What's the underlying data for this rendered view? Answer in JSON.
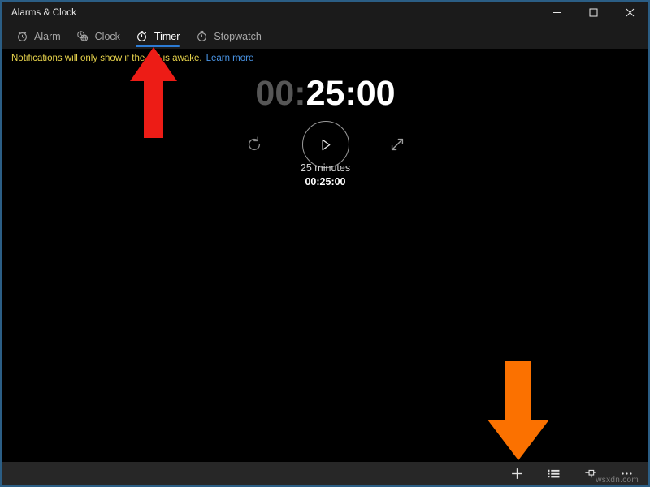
{
  "window": {
    "title": "Alarms & Clock",
    "controls": [
      {
        "name": "minimize",
        "label": "Minimize"
      },
      {
        "name": "maximize",
        "label": "Maximize"
      },
      {
        "name": "close",
        "label": "Close"
      }
    ],
    "accent_color": "#2b5e85"
  },
  "tabs": [
    {
      "id": "alarm",
      "label": "Alarm",
      "icon": "alarm-clock-icon",
      "active": false
    },
    {
      "id": "clock",
      "label": "Clock",
      "icon": "world-clock-icon",
      "active": false
    },
    {
      "id": "timer",
      "label": "Timer",
      "icon": "timer-icon",
      "active": true
    },
    {
      "id": "stopwatch",
      "label": "Stopwatch",
      "icon": "stopwatch-icon",
      "active": false
    }
  ],
  "notification": {
    "text": "Notifications will only show if the PC is awake.",
    "link_label": "Learn more",
    "text_color": "#e8d44c",
    "link_color": "#4a96e8"
  },
  "timer": {
    "display_dim": "00:",
    "display_bright": "25:00",
    "name": "25 minutes",
    "duration": "00:25:00",
    "controls": {
      "reset_label": "Reset",
      "play_label": "Start",
      "expand_label": "Expand"
    }
  },
  "command_bar": [
    {
      "id": "new",
      "label": "New",
      "icon": "plus-icon"
    },
    {
      "id": "edit",
      "label": "Edit",
      "icon": "list-edit-icon"
    },
    {
      "id": "pin",
      "label": "Pin to Start",
      "icon": "pin-icon"
    },
    {
      "id": "more",
      "label": "See more",
      "icon": "ellipsis-icon"
    }
  ],
  "annotations": [
    {
      "id": "red-arrow",
      "direction": "up",
      "color": "#ed1c16",
      "points_to": "Timer tab"
    },
    {
      "id": "orange-arrow",
      "direction": "down",
      "color": "#fb7100",
      "points_to": "New timer button"
    }
  ],
  "watermark": "wsxdn.com"
}
